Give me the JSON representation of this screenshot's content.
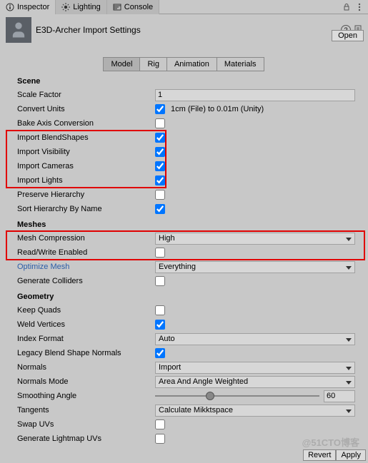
{
  "topTabs": {
    "inspector": "Inspector",
    "lighting": "Lighting",
    "console": "Console"
  },
  "header": {
    "title": "E3D-Archer Import Settings",
    "open": "Open"
  },
  "importerTabs": {
    "model": "Model",
    "rig": "Rig",
    "animation": "Animation",
    "materials": "Materials"
  },
  "sections": {
    "scene": "Scene",
    "meshes": "Meshes",
    "geometry": "Geometry"
  },
  "scene": {
    "scaleFactor": {
      "label": "Scale Factor",
      "value": "1"
    },
    "convertUnits": {
      "label": "Convert Units",
      "hint": "1cm (File) to 0.01m (Unity)"
    },
    "bakeAxisConversion": "Bake Axis Conversion",
    "importBlendShapes": "Import BlendShapes",
    "importVisibility": "Import Visibility",
    "importCameras": "Import Cameras",
    "importLights": "Import Lights",
    "preserveHierarchy": "Preserve Hierarchy",
    "sortHierarchy": "Sort Hierarchy By Name"
  },
  "meshes": {
    "meshCompression": {
      "label": "Mesh Compression",
      "value": "High"
    },
    "readWrite": "Read/Write Enabled",
    "optimizeMesh": {
      "label": "Optimize Mesh",
      "value": "Everything"
    },
    "generateColliders": "Generate Colliders"
  },
  "geometry": {
    "keepQuads": "Keep Quads",
    "weldVertices": "Weld Vertices",
    "indexFormat": {
      "label": "Index Format",
      "value": "Auto"
    },
    "legacyBSNormals": "Legacy Blend Shape Normals",
    "normals": {
      "label": "Normals",
      "value": "Import"
    },
    "normalsMode": {
      "label": "Normals Mode",
      "value": "Area And Angle Weighted"
    },
    "smoothingAngle": {
      "label": "Smoothing Angle",
      "value": "60",
      "percent": 33.3
    },
    "tangents": {
      "label": "Tangents",
      "value": "Calculate Mikktspace"
    },
    "swapUVs": "Swap UVs",
    "generateLightmapUVs": "Generate Lightmap UVs"
  },
  "footer": {
    "revert": "Revert",
    "apply": "Apply"
  },
  "watermark": "@51CTO博客"
}
